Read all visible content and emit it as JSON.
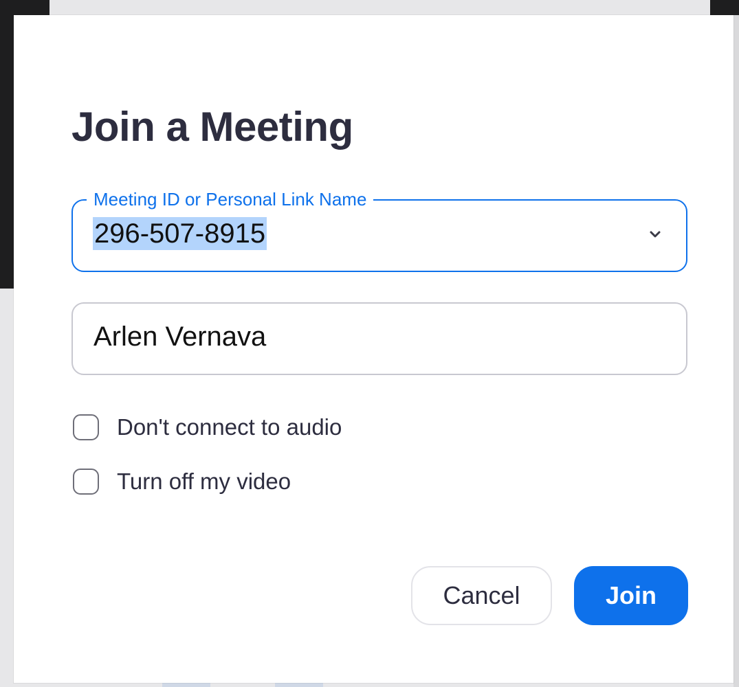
{
  "dialog": {
    "title": "Join a Meeting"
  },
  "meeting_field": {
    "label": "Meeting ID or Personal Link Name",
    "value": "296-507-8915",
    "value_selected": true,
    "dropdown_icon": "chevron-down-icon"
  },
  "name_field": {
    "value": "Arlen Vernava"
  },
  "options": {
    "no_audio_label": "Don't connect to audio",
    "no_audio_checked": false,
    "video_off_label": "Turn off my video",
    "video_off_checked": false
  },
  "buttons": {
    "cancel_label": "Cancel",
    "join_label": "Join"
  },
  "colors": {
    "accent": "#0e71eb",
    "title_text": "#2d2d3f",
    "selection_highlight": "#b3d4fc"
  }
}
